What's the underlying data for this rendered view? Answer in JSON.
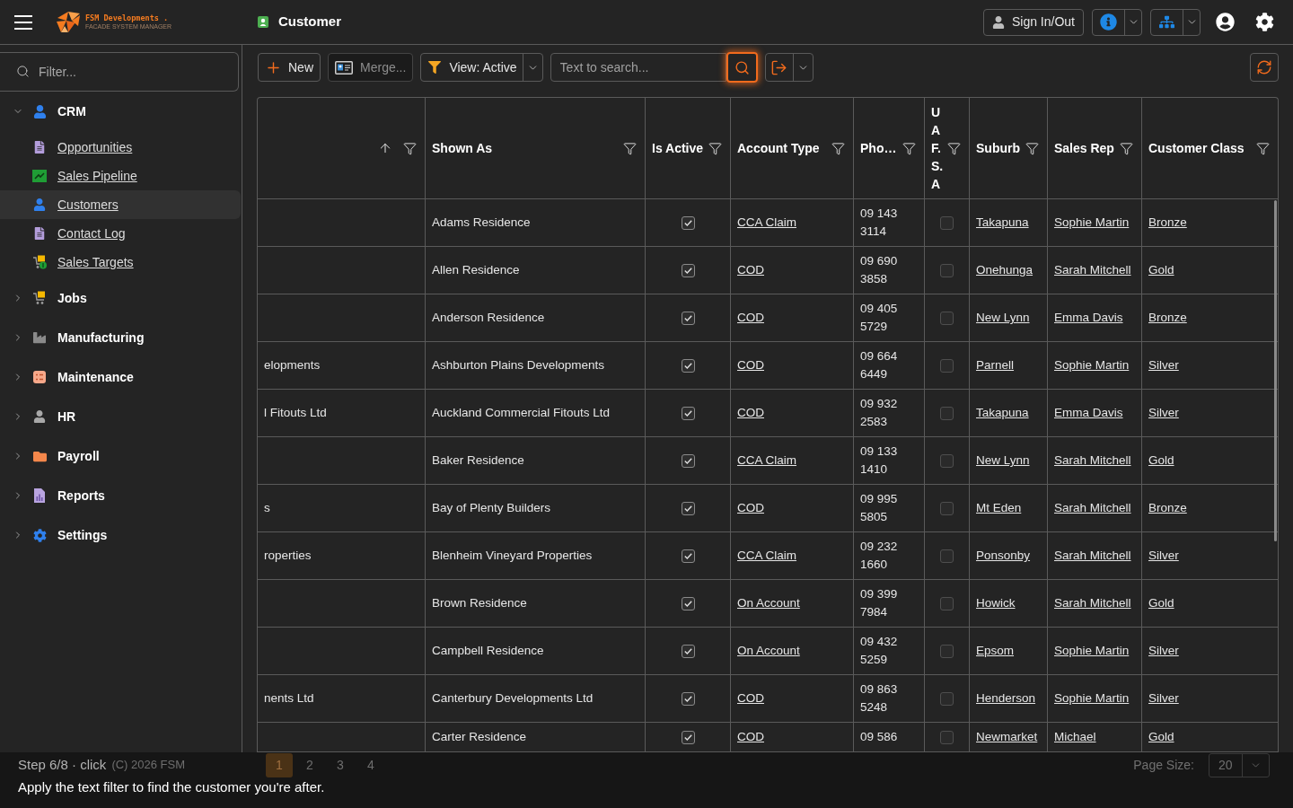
{
  "header": {
    "logo": {
      "name": "FSM Developments .",
      "tagline": "FACADE SYSTEM MANAGER"
    },
    "title": "Customer",
    "sign_in_out": "Sign In/Out"
  },
  "sidebar": {
    "filter": {
      "placeholder": "Filter..."
    },
    "items": [
      {
        "label": "CRM",
        "expanded": true,
        "children": [
          {
            "label": "Opportunities",
            "selected": false
          },
          {
            "label": "Sales Pipeline",
            "selected": false
          },
          {
            "label": "Customers",
            "selected": true
          },
          {
            "label": "Contact Log",
            "selected": false
          },
          {
            "label": "Sales Targets",
            "selected": false
          }
        ]
      },
      {
        "label": "Jobs",
        "expanded": false
      },
      {
        "label": "Manufacturing",
        "expanded": false
      },
      {
        "label": "Maintenance",
        "expanded": false
      },
      {
        "label": "HR",
        "expanded": false
      },
      {
        "label": "Payroll",
        "expanded": false
      },
      {
        "label": "Reports",
        "expanded": false
      },
      {
        "label": "Settings",
        "expanded": false
      }
    ],
    "footer": "(C) 2026 FSM"
  },
  "toolbar": {
    "new": "New",
    "merge": {
      "label": "Merge...",
      "disabled": true
    },
    "view": "View: Active",
    "search": {
      "placeholder": "Text to search...",
      "highlighted": true
    }
  },
  "table": {
    "columns": [
      {
        "kind": "text",
        "sorted": true
      },
      {
        "label": "Shown As",
        "kind": "text",
        "sorted": false
      },
      {
        "label": "Is Active",
        "kind": "check",
        "sorted": false
      },
      {
        "label": "Account Type",
        "kind": "link",
        "sorted": false
      },
      {
        "label": "Pho…",
        "kind": "text",
        "sorted": false
      },
      {
        "label": "UAF.S.A",
        "kind": "check",
        "sorted": false
      },
      {
        "label": "Suburb",
        "kind": "link",
        "sorted": false
      },
      {
        "label": "Sales Rep",
        "kind": "link",
        "sorted": false
      },
      {
        "label": "Customer Class",
        "kind": "link",
        "sorted": false
      }
    ],
    "rows": [
      {
        "shown_as": "Adams Residence",
        "is_active": true,
        "account_type": "CCA Claim",
        "phone": "09 143 3114",
        "uafsa": false,
        "suburb": "Takapuna",
        "sales_rep": "Sophie Martin",
        "customer_class": "Bronze"
      },
      {
        "shown_as": "Allen Residence",
        "is_active": true,
        "account_type": "COD",
        "phone": "09 690 3858",
        "uafsa": false,
        "suburb": "Onehunga",
        "sales_rep": "Sarah Mitchell",
        "customer_class": "Gold"
      },
      {
        "shown_as": "Anderson Residence",
        "is_active": true,
        "account_type": "COD",
        "phone": "09 405 5729",
        "uafsa": false,
        "suburb": "New Lynn",
        "sales_rep": "Emma Davis",
        "customer_class": "Bronze"
      },
      {
        "column_1": "elopments",
        "shown_as": "Ashburton Plains Developments",
        "is_active": true,
        "account_type": "COD",
        "phone": "09 664 6449",
        "uafsa": false,
        "suburb": "Parnell",
        "sales_rep": "Sophie Martin",
        "customer_class": "Silver"
      },
      {
        "column_1": "l Fitouts Ltd",
        "shown_as": "Auckland Commercial Fitouts Ltd",
        "is_active": true,
        "account_type": "COD",
        "phone": "09 932 2583",
        "uafsa": false,
        "suburb": "Takapuna",
        "sales_rep": "Emma Davis",
        "customer_class": "Silver"
      },
      {
        "shown_as": "Baker Residence",
        "is_active": true,
        "account_type": "CCA Claim",
        "phone": "09 133 1410",
        "uafsa": false,
        "suburb": "New Lynn",
        "sales_rep": "Sarah Mitchell",
        "customer_class": "Gold"
      },
      {
        "column_1": "s",
        "shown_as": "Bay of Plenty Builders",
        "is_active": true,
        "account_type": "COD",
        "phone": "09 995 5805",
        "uafsa": false,
        "suburb": "Mt Eden",
        "sales_rep": "Sarah Mitchell",
        "customer_class": "Bronze"
      },
      {
        "column_1": "roperties",
        "shown_as": "Blenheim Vineyard Properties",
        "is_active": true,
        "account_type": "CCA Claim",
        "phone": "09 232 1660",
        "uafsa": false,
        "suburb": "Ponsonby",
        "sales_rep": "Sarah Mitchell",
        "customer_class": "Silver"
      },
      {
        "shown_as": "Brown Residence",
        "is_active": true,
        "account_type": "On Account",
        "phone": "09 399 7984",
        "uafsa": false,
        "suburb": "Howick",
        "sales_rep": "Sarah Mitchell",
        "customer_class": "Gold"
      },
      {
        "shown_as": "Campbell Residence",
        "is_active": true,
        "account_type": "On Account",
        "phone": "09 432 5259",
        "uafsa": false,
        "suburb": "Epsom",
        "sales_rep": "Sophie Martin",
        "customer_class": "Silver"
      },
      {
        "column_1": "nents Ltd",
        "shown_as": "Canterbury Developments Ltd",
        "is_active": true,
        "account_type": "COD",
        "phone": "09 863 5248",
        "uafsa": false,
        "suburb": "Henderson",
        "sales_rep": "Sophie Martin",
        "customer_class": "Silver"
      },
      {
        "shown_as": "Carter Residence",
        "is_active": true,
        "account_type": "COD",
        "phone": "09 586",
        "uafsa": false,
        "suburb": "Newmarket",
        "sales_rep": "Michael",
        "customer_class": "Gold"
      }
    ]
  },
  "pagination": {
    "pages": [
      {
        "label": "1",
        "selected": true
      },
      {
        "label": "2",
        "selected": false
      },
      {
        "label": "3",
        "selected": false
      },
      {
        "label": "4",
        "selected": false
      }
    ],
    "page_size_label": "Page Size:",
    "page_size": "20"
  },
  "tour": {
    "step": "Step 6/8 · click",
    "instruction": "Apply the text filter to find the customer you're after."
  }
}
